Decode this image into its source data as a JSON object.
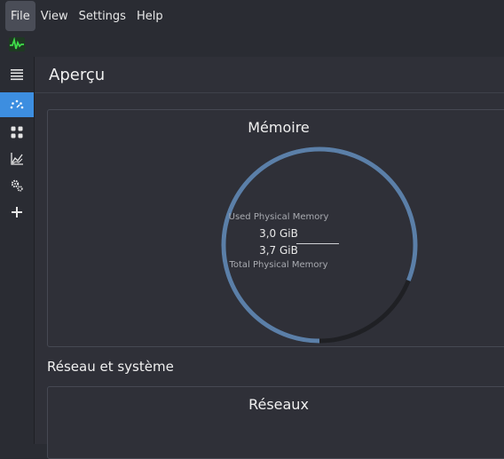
{
  "menubar": {
    "items": [
      "File",
      "View",
      "Settings",
      "Help"
    ]
  },
  "page": {
    "title": "Aperçu"
  },
  "memory_card": {
    "title": "Mémoire",
    "used_label": "Used Physical Memory",
    "used_value": "3,0 GiB",
    "total_value": "3,7 GiB",
    "total_label": "Total Physical Memory",
    "used_fraction": 0.81
  },
  "network_section": {
    "title": "Réseau et système",
    "card_title": "Réseaux"
  },
  "colors": {
    "gauge_fill": "#5b7fa8",
    "gauge_track": "#1f2024",
    "accent": "#3d8ee0"
  },
  "sidebar": {
    "items": [
      "menu-icon",
      "dashboard-gauge-icon",
      "grid-icon",
      "chart-icon",
      "gears-icon",
      "add-icon"
    ]
  }
}
